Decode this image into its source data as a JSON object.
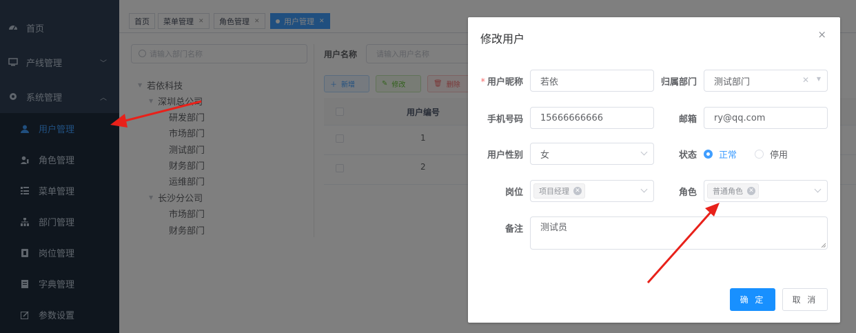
{
  "sidebar": {
    "items": [
      {
        "label": "首页",
        "icon": "dashboard-icon"
      },
      {
        "label": "产线管理",
        "icon": "monitor-icon"
      },
      {
        "label": "系统管理",
        "icon": "gear-icon"
      }
    ],
    "submenu": [
      {
        "label": "用户管理",
        "icon": "user-icon",
        "active": true
      },
      {
        "label": "角色管理",
        "icon": "peoples-icon"
      },
      {
        "label": "菜单管理",
        "icon": "tree-table-icon"
      },
      {
        "label": "部门管理",
        "icon": "tree-icon"
      },
      {
        "label": "岗位管理",
        "icon": "post-icon"
      },
      {
        "label": "字典管理",
        "icon": "dict-icon"
      },
      {
        "label": "参数设置",
        "icon": "edit-icon"
      }
    ]
  },
  "tags": [
    {
      "label": "首页"
    },
    {
      "label": "菜单管理"
    },
    {
      "label": "角色管理"
    },
    {
      "label": "用户管理",
      "active": true
    }
  ],
  "dept": {
    "search_placeholder": "请输入部门名称",
    "tree": [
      {
        "label": "若依科技"
      },
      {
        "label": "深圳总公司"
      },
      {
        "label": "研发部门"
      },
      {
        "label": "市场部门"
      },
      {
        "label": "测试部门"
      },
      {
        "label": "财务部门"
      },
      {
        "label": "运维部门"
      },
      {
        "label": "长沙分公司"
      },
      {
        "label": "市场部门"
      },
      {
        "label": "财务部门"
      }
    ]
  },
  "user_table": {
    "search_label": "用户名称",
    "search_placeholder": "请输入用户名称",
    "btn_add": "新增",
    "btn_edit": "修改",
    "btn_delete": "删除",
    "col_id": "用户编号",
    "rows": [
      {
        "id": "1"
      },
      {
        "id": "2"
      }
    ]
  },
  "dialog": {
    "title": "修改用户",
    "close": "×",
    "nickname_label": "用户昵称",
    "nickname_value": "若依",
    "dept_label": "归属部门",
    "dept_value": "测试部门",
    "phone_label": "手机号码",
    "phone_value": "15666666666",
    "email_label": "邮箱",
    "email_value": "ry@qq.com",
    "sex_label": "用户性别",
    "sex_value": "女",
    "status_label": "状态",
    "status_options": [
      "正常",
      "停用"
    ],
    "status_selected": "正常",
    "post_label": "岗位",
    "post_tag": "项目经理",
    "role_label": "角色",
    "role_tag": "普通角色",
    "remark_label": "备注",
    "remark_value": "测试员",
    "ok": "确 定",
    "cancel": "取 消"
  },
  "colors": {
    "sidebar_bg": "#304156",
    "submenu_bg": "#1f2d3d",
    "primary": "#409eff",
    "annotation_arrow": "#e8211a"
  }
}
